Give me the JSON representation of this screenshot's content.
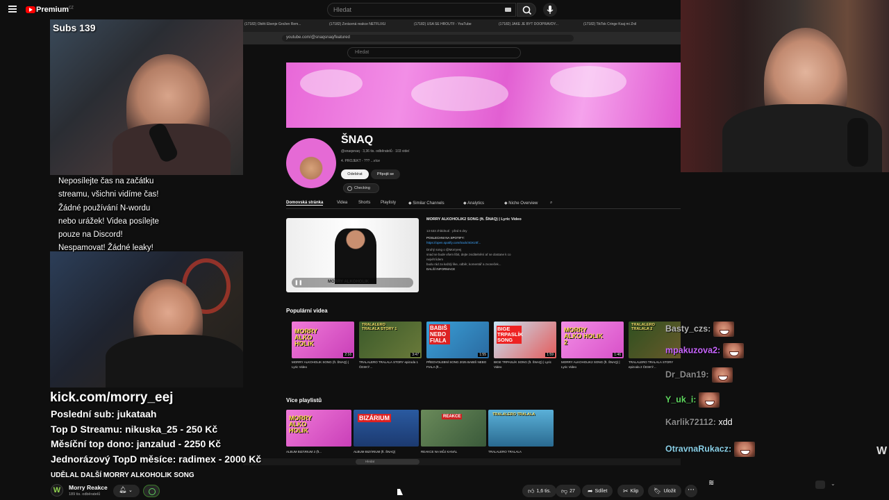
{
  "app": {
    "brand": "Premium",
    "brand_region": "CZ",
    "accent": "#ff0000"
  },
  "search": {
    "placeholder": "Hledat"
  },
  "overlay": {
    "subs": "Subs 139",
    "rules": [
      "Neposílejte čas na začátku",
      "streamu, všichni vidíme čas!",
      "Žádné používání N-wordu",
      "nebo urážek! Videa posílejte",
      "pouze na Discord!",
      "Nespamovat! Žádné leaky!"
    ],
    "kick": "kick.com/morry_eej",
    "stats": [
      "Poslední sub: jukataah",
      "Top D Streamu: nikuska_25 - 250 Kč",
      "Měsíční top dono: janzalud - 2250 Kč",
      "Jednorázový TopD měsíce: radimex - 2000 Kč"
    ]
  },
  "capture": {
    "url": "youtube.com/@snaqsnaq/featured",
    "tabs": [
      "(17182) Oběti Ebenje Grožen Rem...",
      "(17182) Zvrácená reakce NETFLIXU",
      "(17182) USA SE HROUTÍ! - YouTube",
      "(17182) JAKÉ JE BÝT DOOPRAVDY...",
      "(17182) TikTok Cringe Ksaj mi Znil"
    ],
    "search_placeholder": "Hledat",
    "channel": {
      "name": "ŠNAQ",
      "meta": "@snaqsnaq · 3,36 tis. odběratelů · 103 videí",
      "desc": "4. PROJEKT - ??? ...více",
      "subscribe": "Odebírat",
      "join": "Připojit se",
      "checking": "Checking"
    },
    "channel_tabs": [
      "Domovská stránka",
      "Videa",
      "Shorts",
      "Playlisty",
      "Similar Channels",
      "Analytics",
      "Niche Overview"
    ],
    "featured": {
      "title": "MORRY ALKOHOLIK2 SONG (ft. ŠNAQ) | Lyric Video",
      "views": "13 633 zhlédnutí · před 6 dny",
      "desc1": "POSLECHNI NA SPOTIFY:",
      "link": "https://open.spotify.com/track/4GKz0f...",
      "desc2": "Druhý song o @Morryeej",
      "desc3": "snad se bude všem líbit, dejte zviditelnění ať se dostane k co",
      "desc4": "největ lidem",
      "desc5": "budu rád za každý like, odběr, komentář a zvoneček...",
      "more": "DALŠÍ INFORMACE",
      "thumb_text": "MORRY ALKOHOLIK"
    },
    "popular_heading": "Populární videa",
    "popular": [
      {
        "thumb": "MORRY ALKO HOLIK",
        "label": "MORRY ALKOHOLIK SONG (ft. ŠNAQ) | Lyric Video",
        "meta": "před 3 týdny",
        "duration": "2:16"
      },
      {
        "thumb": "TRALALERO TRALALA STORY 1",
        "label": "TRALALERO TRALALA STORY epizoda 1 ČESKÝ...",
        "meta": "před 6 měsíci",
        "duration": "3:47"
      },
      {
        "thumb": "BABIŠ NEBO FIALA",
        "label": "PŘEDVOLEBNÍ SONG 2025 BABIŠ NEBO FIALA (ft....",
        "meta": "před 3 měsíci",
        "duration": "1:55"
      },
      {
        "thumb": "BIGE TRPASLÍK SONG",
        "label": "BIGE TRPASLÍK SONG (ft. ŠNAQ) | Lyric Video",
        "meta": "před 4 měsíci",
        "duration": "1:59"
      },
      {
        "thumb": "MORRY ALKO HOLIK 2",
        "label": "MORRY ALKOHOLIK2 SONG (ft. ŠNAQ) | Lyric Video",
        "meta": "před 6 dny",
        "duration": "1:46"
      },
      {
        "thumb": "TRALALERO TRALALA 2",
        "label": "TRALALERO TRALALA STORY epizoda 2 ČESKÝ...",
        "meta": "před 5 měsíci",
        "duration": ""
      }
    ],
    "playlists_heading": "Více playlistů",
    "playlists": [
      {
        "thumb": "MORRY ALKO HOLIK",
        "label": "ALBUM BIZÁRIUM 2 (ft..."
      },
      {
        "thumb": "BIZÁRIUM",
        "label": "ALBUM BIZÁRIUM (ft. ŠNAQ)"
      },
      {
        "thumb": "REAKCE",
        "label": "REAKCE NA MŮJ KANÁL"
      },
      {
        "thumb": "TRALALERO TRALALA",
        "label": "TRALALERO TRALALA"
      }
    ],
    "taskbar_search": "Hledat"
  },
  "chat": [
    {
      "user": "Basty_czs:",
      "color": "#b7b7b7",
      "msg": ""
    },
    {
      "user": "mpakuzova2:",
      "color": "#c966ff",
      "msg": ""
    },
    {
      "user": "Dr_Dan19:",
      "color": "#8a8a8a",
      "msg": ""
    },
    {
      "user": "Y_uk_i:",
      "color": "#5fd65f",
      "msg": ""
    },
    {
      "user": "Karlik72112:",
      "color": "#8a8a8a",
      "msg": "xdd"
    },
    {
      "user": "OtravnaRukacz:",
      "color": "#8acfe6",
      "msg": ""
    }
  ],
  "video": {
    "title": "UDĚLAL DALŠÍ MORRY ALKOHOLIK SONG",
    "channel": "Morry Reakce",
    "subscribers": "189 tis. odběratelů",
    "likes": "1,6 tis.",
    "dislikes": "27",
    "share": "Sdílet",
    "clip": "Klip",
    "save": "Uložit"
  }
}
